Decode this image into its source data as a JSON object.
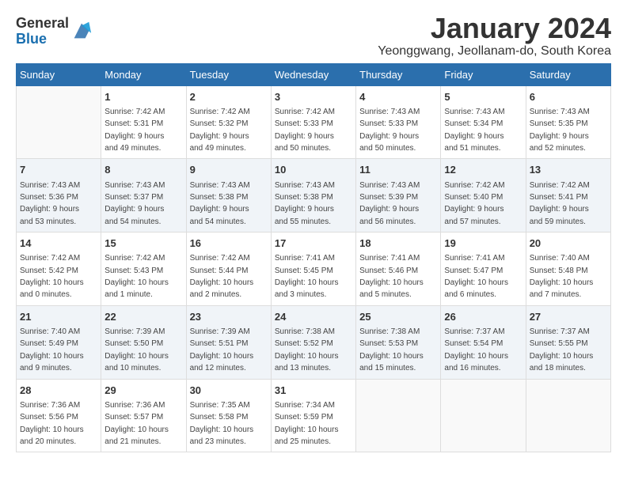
{
  "header": {
    "logo_general": "General",
    "logo_blue": "Blue",
    "title": "January 2024",
    "subtitle": "Yeonggwang, Jeollanam-do, South Korea"
  },
  "days_of_week": [
    "Sunday",
    "Monday",
    "Tuesday",
    "Wednesday",
    "Thursday",
    "Friday",
    "Saturday"
  ],
  "weeks": [
    [
      {
        "day": "",
        "info": ""
      },
      {
        "day": "1",
        "info": "Sunrise: 7:42 AM\nSunset: 5:31 PM\nDaylight: 9 hours\nand 49 minutes."
      },
      {
        "day": "2",
        "info": "Sunrise: 7:42 AM\nSunset: 5:32 PM\nDaylight: 9 hours\nand 49 minutes."
      },
      {
        "day": "3",
        "info": "Sunrise: 7:42 AM\nSunset: 5:33 PM\nDaylight: 9 hours\nand 50 minutes."
      },
      {
        "day": "4",
        "info": "Sunrise: 7:43 AM\nSunset: 5:33 PM\nDaylight: 9 hours\nand 50 minutes."
      },
      {
        "day": "5",
        "info": "Sunrise: 7:43 AM\nSunset: 5:34 PM\nDaylight: 9 hours\nand 51 minutes."
      },
      {
        "day": "6",
        "info": "Sunrise: 7:43 AM\nSunset: 5:35 PM\nDaylight: 9 hours\nand 52 minutes."
      }
    ],
    [
      {
        "day": "7",
        "info": "Sunrise: 7:43 AM\nSunset: 5:36 PM\nDaylight: 9 hours\nand 53 minutes."
      },
      {
        "day": "8",
        "info": "Sunrise: 7:43 AM\nSunset: 5:37 PM\nDaylight: 9 hours\nand 54 minutes."
      },
      {
        "day": "9",
        "info": "Sunrise: 7:43 AM\nSunset: 5:38 PM\nDaylight: 9 hours\nand 54 minutes."
      },
      {
        "day": "10",
        "info": "Sunrise: 7:43 AM\nSunset: 5:38 PM\nDaylight: 9 hours\nand 55 minutes."
      },
      {
        "day": "11",
        "info": "Sunrise: 7:43 AM\nSunset: 5:39 PM\nDaylight: 9 hours\nand 56 minutes."
      },
      {
        "day": "12",
        "info": "Sunrise: 7:42 AM\nSunset: 5:40 PM\nDaylight: 9 hours\nand 57 minutes."
      },
      {
        "day": "13",
        "info": "Sunrise: 7:42 AM\nSunset: 5:41 PM\nDaylight: 9 hours\nand 59 minutes."
      }
    ],
    [
      {
        "day": "14",
        "info": "Sunrise: 7:42 AM\nSunset: 5:42 PM\nDaylight: 10 hours\nand 0 minutes."
      },
      {
        "day": "15",
        "info": "Sunrise: 7:42 AM\nSunset: 5:43 PM\nDaylight: 10 hours\nand 1 minute."
      },
      {
        "day": "16",
        "info": "Sunrise: 7:42 AM\nSunset: 5:44 PM\nDaylight: 10 hours\nand 2 minutes."
      },
      {
        "day": "17",
        "info": "Sunrise: 7:41 AM\nSunset: 5:45 PM\nDaylight: 10 hours\nand 3 minutes."
      },
      {
        "day": "18",
        "info": "Sunrise: 7:41 AM\nSunset: 5:46 PM\nDaylight: 10 hours\nand 5 minutes."
      },
      {
        "day": "19",
        "info": "Sunrise: 7:41 AM\nSunset: 5:47 PM\nDaylight: 10 hours\nand 6 minutes."
      },
      {
        "day": "20",
        "info": "Sunrise: 7:40 AM\nSunset: 5:48 PM\nDaylight: 10 hours\nand 7 minutes."
      }
    ],
    [
      {
        "day": "21",
        "info": "Sunrise: 7:40 AM\nSunset: 5:49 PM\nDaylight: 10 hours\nand 9 minutes."
      },
      {
        "day": "22",
        "info": "Sunrise: 7:39 AM\nSunset: 5:50 PM\nDaylight: 10 hours\nand 10 minutes."
      },
      {
        "day": "23",
        "info": "Sunrise: 7:39 AM\nSunset: 5:51 PM\nDaylight: 10 hours\nand 12 minutes."
      },
      {
        "day": "24",
        "info": "Sunrise: 7:38 AM\nSunset: 5:52 PM\nDaylight: 10 hours\nand 13 minutes."
      },
      {
        "day": "25",
        "info": "Sunrise: 7:38 AM\nSunset: 5:53 PM\nDaylight: 10 hours\nand 15 minutes."
      },
      {
        "day": "26",
        "info": "Sunrise: 7:37 AM\nSunset: 5:54 PM\nDaylight: 10 hours\nand 16 minutes."
      },
      {
        "day": "27",
        "info": "Sunrise: 7:37 AM\nSunset: 5:55 PM\nDaylight: 10 hours\nand 18 minutes."
      }
    ],
    [
      {
        "day": "28",
        "info": "Sunrise: 7:36 AM\nSunset: 5:56 PM\nDaylight: 10 hours\nand 20 minutes."
      },
      {
        "day": "29",
        "info": "Sunrise: 7:36 AM\nSunset: 5:57 PM\nDaylight: 10 hours\nand 21 minutes."
      },
      {
        "day": "30",
        "info": "Sunrise: 7:35 AM\nSunset: 5:58 PM\nDaylight: 10 hours\nand 23 minutes."
      },
      {
        "day": "31",
        "info": "Sunrise: 7:34 AM\nSunset: 5:59 PM\nDaylight: 10 hours\nand 25 minutes."
      },
      {
        "day": "",
        "info": ""
      },
      {
        "day": "",
        "info": ""
      },
      {
        "day": "",
        "info": ""
      }
    ]
  ]
}
